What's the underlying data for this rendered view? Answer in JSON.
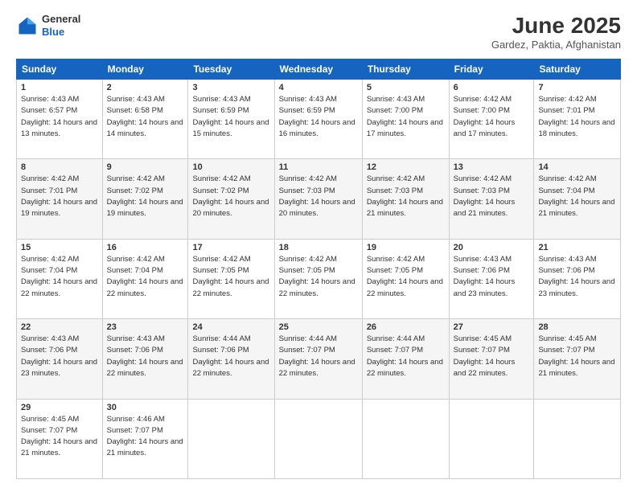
{
  "header": {
    "logo_general": "General",
    "logo_blue": "Blue",
    "month_year": "June 2025",
    "location": "Gardez, Paktia, Afghanistan"
  },
  "weekdays": [
    "Sunday",
    "Monday",
    "Tuesday",
    "Wednesday",
    "Thursday",
    "Friday",
    "Saturday"
  ],
  "weeks": [
    [
      {
        "day": "1",
        "sunrise": "Sunrise: 4:43 AM",
        "sunset": "Sunset: 6:57 PM",
        "daylight": "Daylight: 14 hours and 13 minutes."
      },
      {
        "day": "2",
        "sunrise": "Sunrise: 4:43 AM",
        "sunset": "Sunset: 6:58 PM",
        "daylight": "Daylight: 14 hours and 14 minutes."
      },
      {
        "day": "3",
        "sunrise": "Sunrise: 4:43 AM",
        "sunset": "Sunset: 6:59 PM",
        "daylight": "Daylight: 14 hours and 15 minutes."
      },
      {
        "day": "4",
        "sunrise": "Sunrise: 4:43 AM",
        "sunset": "Sunset: 6:59 PM",
        "daylight": "Daylight: 14 hours and 16 minutes."
      },
      {
        "day": "5",
        "sunrise": "Sunrise: 4:43 AM",
        "sunset": "Sunset: 7:00 PM",
        "daylight": "Daylight: 14 hours and 17 minutes."
      },
      {
        "day": "6",
        "sunrise": "Sunrise: 4:42 AM",
        "sunset": "Sunset: 7:00 PM",
        "daylight": "Daylight: 14 hours and 17 minutes."
      },
      {
        "day": "7",
        "sunrise": "Sunrise: 4:42 AM",
        "sunset": "Sunset: 7:01 PM",
        "daylight": "Daylight: 14 hours and 18 minutes."
      }
    ],
    [
      {
        "day": "8",
        "sunrise": "Sunrise: 4:42 AM",
        "sunset": "Sunset: 7:01 PM",
        "daylight": "Daylight: 14 hours and 19 minutes."
      },
      {
        "day": "9",
        "sunrise": "Sunrise: 4:42 AM",
        "sunset": "Sunset: 7:02 PM",
        "daylight": "Daylight: 14 hours and 19 minutes."
      },
      {
        "day": "10",
        "sunrise": "Sunrise: 4:42 AM",
        "sunset": "Sunset: 7:02 PM",
        "daylight": "Daylight: 14 hours and 20 minutes."
      },
      {
        "day": "11",
        "sunrise": "Sunrise: 4:42 AM",
        "sunset": "Sunset: 7:03 PM",
        "daylight": "Daylight: 14 hours and 20 minutes."
      },
      {
        "day": "12",
        "sunrise": "Sunrise: 4:42 AM",
        "sunset": "Sunset: 7:03 PM",
        "daylight": "Daylight: 14 hours and 21 minutes."
      },
      {
        "day": "13",
        "sunrise": "Sunrise: 4:42 AM",
        "sunset": "Sunset: 7:03 PM",
        "daylight": "Daylight: 14 hours and 21 minutes."
      },
      {
        "day": "14",
        "sunrise": "Sunrise: 4:42 AM",
        "sunset": "Sunset: 7:04 PM",
        "daylight": "Daylight: 14 hours and 21 minutes."
      }
    ],
    [
      {
        "day": "15",
        "sunrise": "Sunrise: 4:42 AM",
        "sunset": "Sunset: 7:04 PM",
        "daylight": "Daylight: 14 hours and 22 minutes."
      },
      {
        "day": "16",
        "sunrise": "Sunrise: 4:42 AM",
        "sunset": "Sunset: 7:04 PM",
        "daylight": "Daylight: 14 hours and 22 minutes."
      },
      {
        "day": "17",
        "sunrise": "Sunrise: 4:42 AM",
        "sunset": "Sunset: 7:05 PM",
        "daylight": "Daylight: 14 hours and 22 minutes."
      },
      {
        "day": "18",
        "sunrise": "Sunrise: 4:42 AM",
        "sunset": "Sunset: 7:05 PM",
        "daylight": "Daylight: 14 hours and 22 minutes."
      },
      {
        "day": "19",
        "sunrise": "Sunrise: 4:42 AM",
        "sunset": "Sunset: 7:05 PM",
        "daylight": "Daylight: 14 hours and 22 minutes."
      },
      {
        "day": "20",
        "sunrise": "Sunrise: 4:43 AM",
        "sunset": "Sunset: 7:06 PM",
        "daylight": "Daylight: 14 hours and 23 minutes."
      },
      {
        "day": "21",
        "sunrise": "Sunrise: 4:43 AM",
        "sunset": "Sunset: 7:06 PM",
        "daylight": "Daylight: 14 hours and 23 minutes."
      }
    ],
    [
      {
        "day": "22",
        "sunrise": "Sunrise: 4:43 AM",
        "sunset": "Sunset: 7:06 PM",
        "daylight": "Daylight: 14 hours and 23 minutes."
      },
      {
        "day": "23",
        "sunrise": "Sunrise: 4:43 AM",
        "sunset": "Sunset: 7:06 PM",
        "daylight": "Daylight: 14 hours and 22 minutes."
      },
      {
        "day": "24",
        "sunrise": "Sunrise: 4:44 AM",
        "sunset": "Sunset: 7:06 PM",
        "daylight": "Daylight: 14 hours and 22 minutes."
      },
      {
        "day": "25",
        "sunrise": "Sunrise: 4:44 AM",
        "sunset": "Sunset: 7:07 PM",
        "daylight": "Daylight: 14 hours and 22 minutes."
      },
      {
        "day": "26",
        "sunrise": "Sunrise: 4:44 AM",
        "sunset": "Sunset: 7:07 PM",
        "daylight": "Daylight: 14 hours and 22 minutes."
      },
      {
        "day": "27",
        "sunrise": "Sunrise: 4:45 AM",
        "sunset": "Sunset: 7:07 PM",
        "daylight": "Daylight: 14 hours and 22 minutes."
      },
      {
        "day": "28",
        "sunrise": "Sunrise: 4:45 AM",
        "sunset": "Sunset: 7:07 PM",
        "daylight": "Daylight: 14 hours and 21 minutes."
      }
    ],
    [
      {
        "day": "29",
        "sunrise": "Sunrise: 4:45 AM",
        "sunset": "Sunset: 7:07 PM",
        "daylight": "Daylight: 14 hours and 21 minutes."
      },
      {
        "day": "30",
        "sunrise": "Sunrise: 4:46 AM",
        "sunset": "Sunset: 7:07 PM",
        "daylight": "Daylight: 14 hours and 21 minutes."
      },
      null,
      null,
      null,
      null,
      null
    ]
  ]
}
